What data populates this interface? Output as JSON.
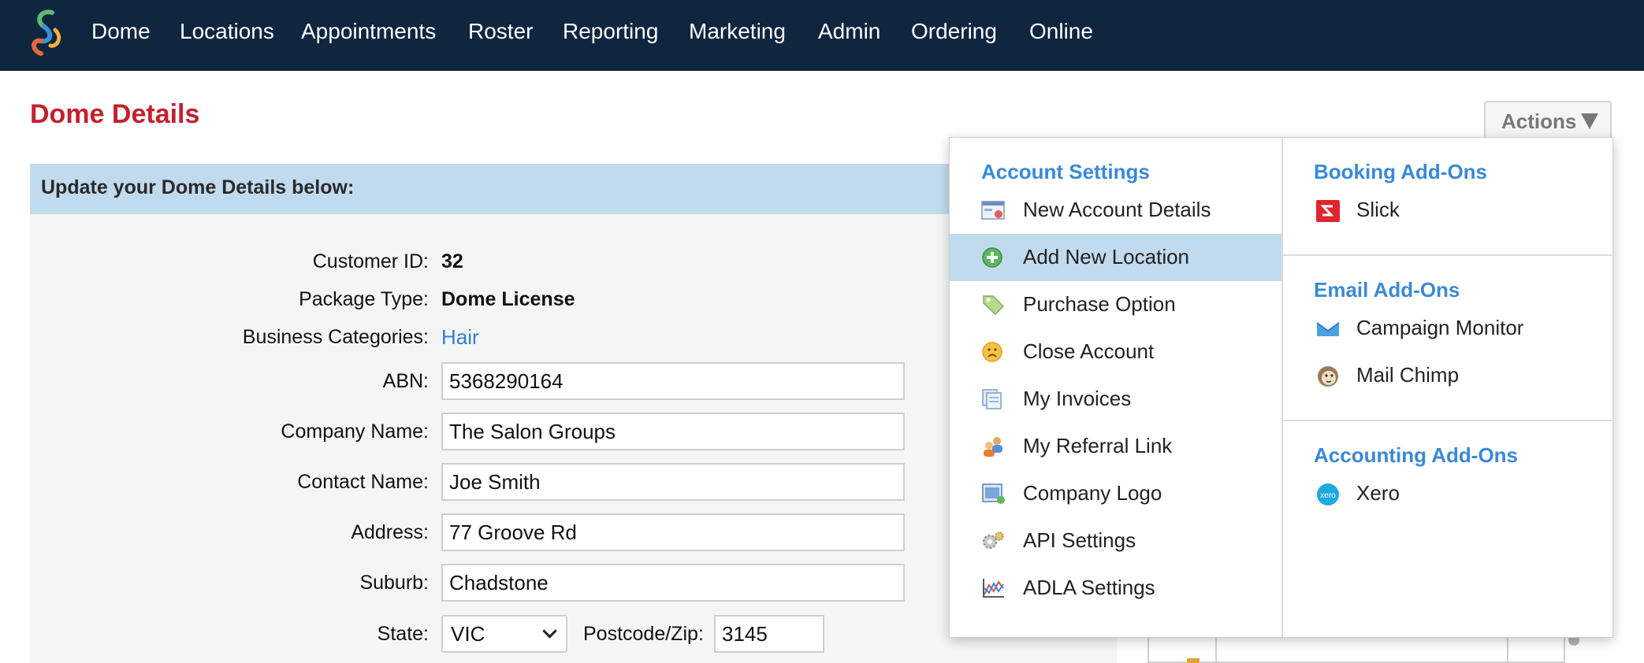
{
  "nav": {
    "items": [
      "Dome",
      "Locations",
      "Appointments",
      "Roster",
      "Reporting",
      "Marketing",
      "Admin",
      "Ordering",
      "Online"
    ]
  },
  "page": {
    "title": "Dome Details",
    "actions_label": "Actions"
  },
  "panel": {
    "header": "Update your Dome Details below:",
    "fields": {
      "customer_id": {
        "label": "Customer ID:",
        "value": "32"
      },
      "package_type": {
        "label": "Package Type:",
        "value": "Dome License"
      },
      "business_categories": {
        "label": "Business Categories:",
        "value": "Hair"
      },
      "abn": {
        "label": "ABN:",
        "value": "5368290164"
      },
      "company_name": {
        "label": "Company Name:",
        "value": "The Salon Groups"
      },
      "contact_name": {
        "label": "Contact Name:",
        "value": "Joe Smith"
      },
      "address": {
        "label": "Address:",
        "value": "77 Groove Rd"
      },
      "suburb": {
        "label": "Suburb:",
        "value": "Chadstone"
      },
      "state": {
        "label": "State:",
        "value": "VIC"
      },
      "postcode": {
        "label": "Postcode/Zip:",
        "value": "3145"
      }
    }
  },
  "actions_menu": {
    "account_settings": {
      "title": "Account Settings",
      "items": [
        {
          "label": "New Account Details",
          "icon": "account-details-icon"
        },
        {
          "label": "Add New Location",
          "icon": "add-circle-icon"
        },
        {
          "label": "Purchase Option",
          "icon": "tag-icon"
        },
        {
          "label": "Close Account",
          "icon": "sad-face-icon"
        },
        {
          "label": "My Invoices",
          "icon": "invoices-icon"
        },
        {
          "label": "My Referral Link",
          "icon": "referral-people-icon"
        },
        {
          "label": "Company Logo",
          "icon": "image-icon"
        },
        {
          "label": "API Settings",
          "icon": "gears-icon"
        },
        {
          "label": "ADLA Settings",
          "icon": "chart-icon"
        }
      ]
    },
    "booking_addons": {
      "title": "Booking Add-Ons",
      "items": [
        {
          "label": "Slick",
          "icon": "slick-logo-icon"
        }
      ]
    },
    "email_addons": {
      "title": "Email Add-Ons",
      "items": [
        {
          "label": "Campaign Monitor",
          "icon": "campaign-monitor-icon"
        },
        {
          "label": "Mail Chimp",
          "icon": "mailchimp-icon"
        }
      ]
    },
    "accounting_addons": {
      "title": "Accounting Add-Ons",
      "items": [
        {
          "label": "Xero",
          "icon": "xero-icon"
        }
      ]
    }
  },
  "colors": {
    "nav_bg": "#0f2540",
    "title_red": "#c4202c",
    "section_blue": "#3a89d8",
    "highlight": "#c2daed",
    "link_blue": "#2f7fd6"
  }
}
